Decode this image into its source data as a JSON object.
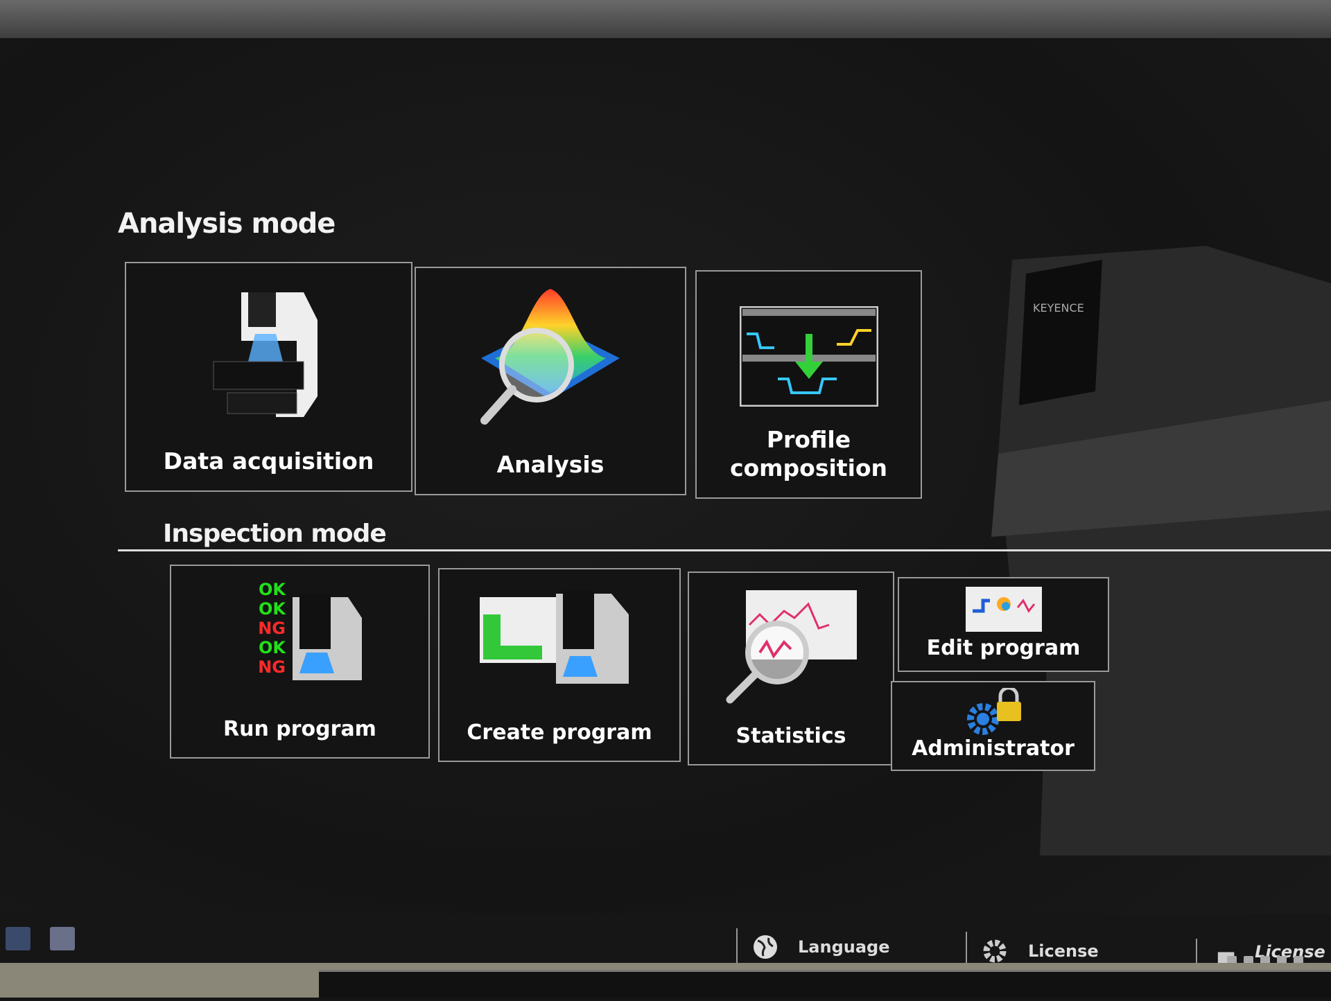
{
  "analysis_mode": {
    "title": "Analysis mode",
    "tiles": [
      {
        "label": "Data acquisition",
        "icon": "microscope-icon"
      },
      {
        "label": "Analysis",
        "icon": "3d-surface-magnifier-icon"
      },
      {
        "label": "Profile composition",
        "icon": "profile-composition-icon"
      }
    ]
  },
  "inspection_mode": {
    "title": "Inspection mode",
    "tiles": [
      {
        "label": "Run program",
        "icon": "ok-ng-microscope-icon",
        "status_labels": [
          "OK",
          "OK",
          "NG",
          "OK",
          "NG"
        ]
      },
      {
        "label": "Create program",
        "icon": "chart-microscope-icon"
      },
      {
        "label": "Statistics",
        "icon": "chart-magnifier-icon"
      },
      {
        "label": "Edit program",
        "icon": "edit-program-icon"
      },
      {
        "label": "Administrator",
        "icon": "gear-lock-icon"
      }
    ]
  },
  "bottom_bar": {
    "language": "Language",
    "license": "License",
    "license_transfer": "License t"
  },
  "brand": "KEYENCE",
  "colors": {
    "ok": "#22e01a",
    "ng": "#ff2a2a",
    "accent_blue": "#2a7fe0"
  }
}
